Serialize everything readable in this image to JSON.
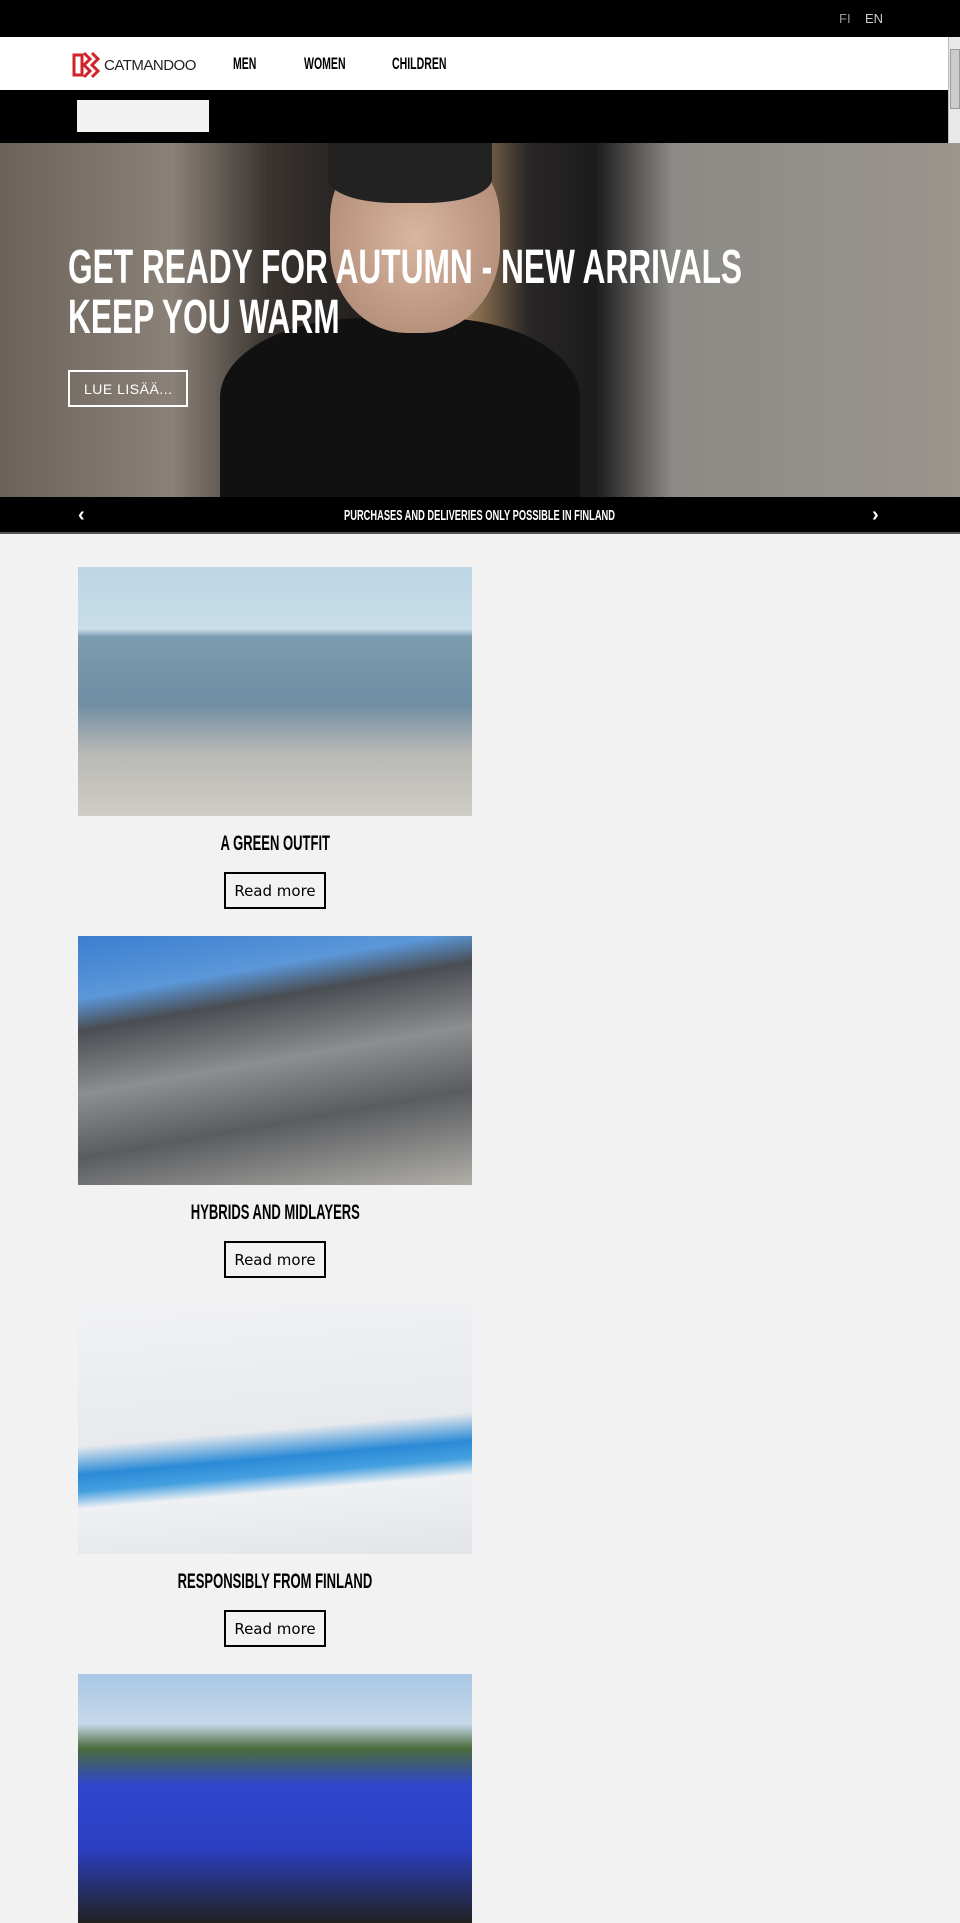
{
  "topbar": {
    "languages": [
      "FI",
      "EN"
    ]
  },
  "nav": {
    "brand": "CATMANDOO",
    "links": [
      "MEN",
      "WOMEN",
      "CHILDREN"
    ]
  },
  "search": {
    "placeholder": ""
  },
  "hero": {
    "title": "GET READY FOR AUTUMN - NEW ARRIVALS KEEP YOU WARM",
    "button": "LUE LISÄÄ..."
  },
  "notice": {
    "text": "PURCHASES AND DELIVERIES ONLY POSSIBLE IN FINLAND",
    "prev_icon": "chevron-left-icon",
    "next_icon": "chevron-right-icon"
  },
  "cards": [
    {
      "title": "A GREEN OUTFIT",
      "button": "Read more"
    },
    {
      "title": "HYBRIDS AND MIDLAYERS",
      "button": "Read more"
    },
    {
      "title": "RESPONSIBLY FROM FINLAND",
      "button": "Read more"
    },
    {
      "title": "",
      "button": ""
    }
  ],
  "colors": {
    "brand_red": "#d2232a",
    "background": "#f2f2f2",
    "bars": "#000000"
  }
}
